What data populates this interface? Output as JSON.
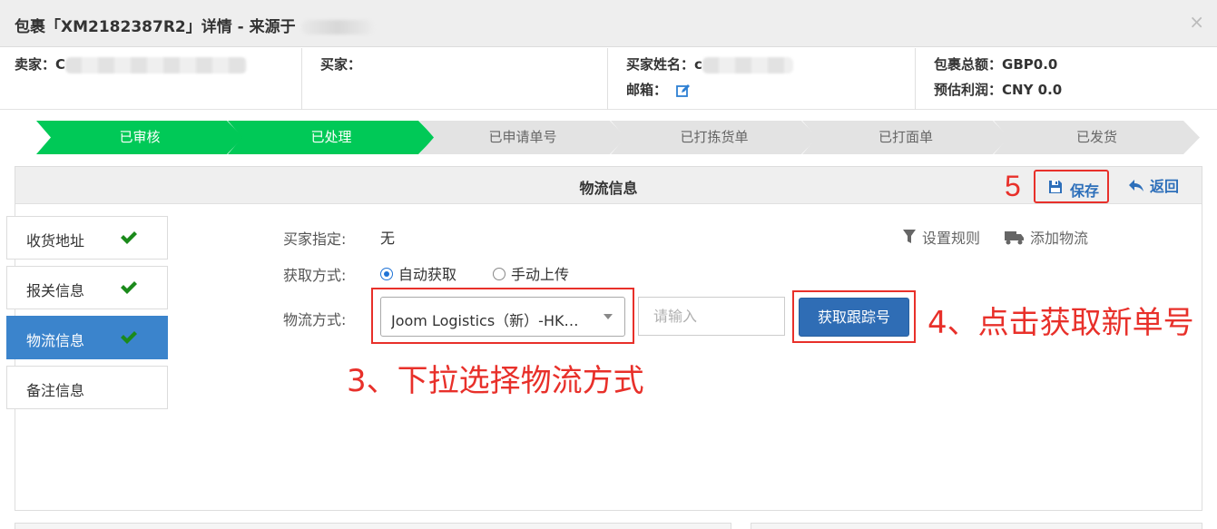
{
  "modal": {
    "title": "包裹「XM2182387R2」详情 - 来源于",
    "close_label": "×"
  },
  "info": {
    "seller_label": "卖家：",
    "seller_value": "C",
    "buyer_label": "买家：",
    "buyer_name_label": "买家姓名：",
    "buyer_name_value": "c",
    "email_label": "邮箱：",
    "total_label": "包裹总额：",
    "total_value": "GBP0.0",
    "profit_label": "预估利润：",
    "profit_value": "CNY 0.0"
  },
  "steps": [
    {
      "label": "已审核",
      "done": true
    },
    {
      "label": "已处理",
      "done": true
    },
    {
      "label": "已申请单号",
      "done": false
    },
    {
      "label": "已打拣货单",
      "done": false
    },
    {
      "label": "已打面单",
      "done": false
    },
    {
      "label": "已发货",
      "done": false
    }
  ],
  "panel": {
    "title": "物流信息",
    "save_label": "保存",
    "back_label": "返回"
  },
  "sidebar": {
    "items": [
      {
        "label": "收货地址",
        "checked": true,
        "active": false
      },
      {
        "label": "报关信息",
        "checked": true,
        "active": false
      },
      {
        "label": "物流信息",
        "checked": true,
        "active": true
      },
      {
        "label": "备注信息",
        "checked": false,
        "active": false
      }
    ]
  },
  "form": {
    "buyer_specified_label": "买家指定:",
    "buyer_specified_value": "无",
    "method_label": "获取方式:",
    "radio_auto": "自动获取",
    "radio_manual": "手动上传",
    "shipping_label": "物流方式:",
    "shipping_selected": "Joom Logistics（新）-HK…",
    "tracking_placeholder": "请输入",
    "get_tracking_label": "获取跟踪号",
    "set_rules_label": "设置规则",
    "add_shipping_label": "添加物流"
  },
  "annotations": {
    "step3": "3、下拉选择物流方式",
    "step4": "4、点击获取新单号",
    "step5": "5"
  },
  "colors": {
    "step_done": "#00c957",
    "step_pending": "#e3e3e3",
    "primary": "#2f6db5",
    "annotation": "#e8302a",
    "check": "#1b8a1b"
  }
}
